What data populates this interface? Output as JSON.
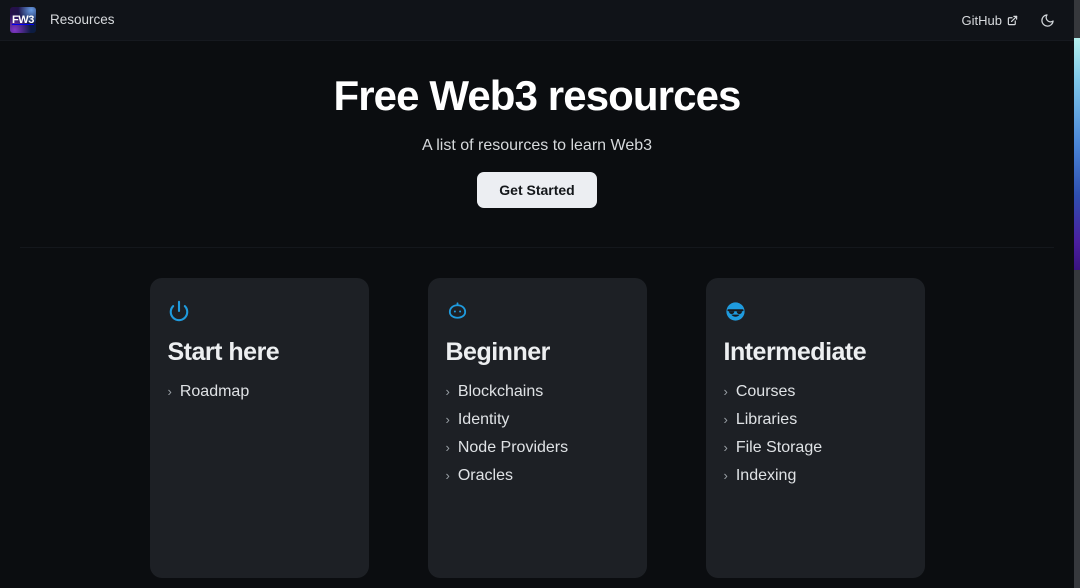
{
  "navbar": {
    "logo_text": "FW3",
    "logo_icon": "fw3-logo-icon",
    "resources_label": "Resources",
    "github_label": "GitHub",
    "external_link_icon": "external-link-icon",
    "theme_toggle_icon": "moon-icon"
  },
  "hero": {
    "title": "Free Web3 resources",
    "subtitle": "A list of resources to learn Web3",
    "cta_label": "Get Started"
  },
  "cards": [
    {
      "icon": "power-icon",
      "title": "Start here",
      "chevron": "›",
      "links": [
        {
          "label": "Roadmap"
        }
      ]
    },
    {
      "icon": "baby-face-icon",
      "title": "Beginner",
      "chevron": "›",
      "links": [
        {
          "label": "Blockchains"
        },
        {
          "label": "Identity"
        },
        {
          "label": "Node Providers"
        },
        {
          "label": "Oracles"
        }
      ]
    },
    {
      "icon": "sunglasses-face-icon",
      "title": "Intermediate",
      "chevron": "›",
      "links": [
        {
          "label": "Courses"
        },
        {
          "label": "Libraries"
        },
        {
          "label": "File Storage"
        },
        {
          "label": "Indexing"
        }
      ]
    }
  ],
  "colors": {
    "page_background": "#0b0d10",
    "navbar_background": "#101318",
    "card_background": "#1d2025",
    "accent_blue": "#1f9bde",
    "cta_background": "#eceef2",
    "cta_text": "#14171a",
    "scrollbar_track": "#36383c"
  }
}
